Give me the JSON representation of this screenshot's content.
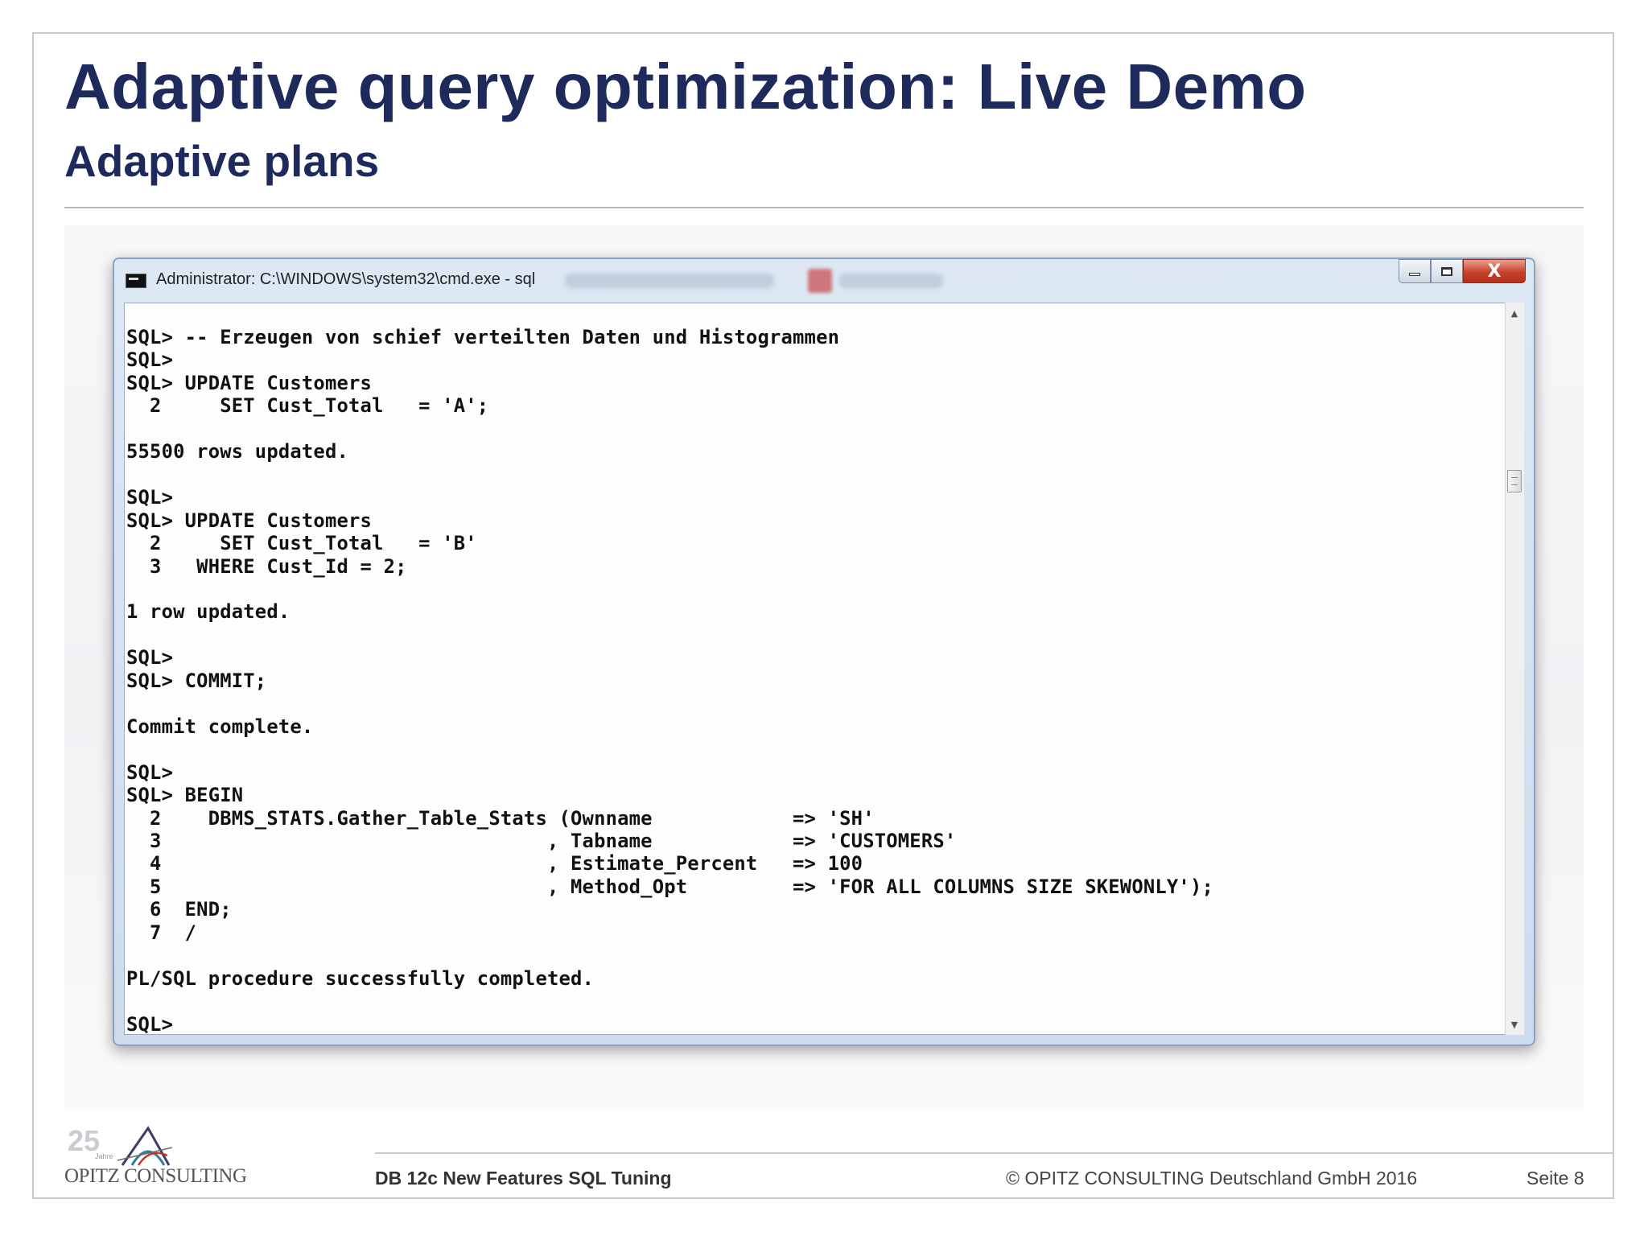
{
  "slide": {
    "title": "Adaptive query optimization: Live Demo",
    "subtitle": "Adaptive plans"
  },
  "window": {
    "title": "Administrator: C:\\WINDOWS\\system32\\cmd.exe - sql",
    "close_glyph": "X",
    "console_lines": [
      "SQL> -- Erzeugen von schief verteilten Daten und Histogrammen",
      "SQL>",
      "SQL> UPDATE Customers",
      "  2     SET Cust_Total   = 'A';",
      "",
      "55500 rows updated.",
      "",
      "SQL>",
      "SQL> UPDATE Customers",
      "  2     SET Cust_Total   = 'B'",
      "  3   WHERE Cust_Id = 2;",
      "",
      "1 row updated.",
      "",
      "SQL>",
      "SQL> COMMIT;",
      "",
      "Commit complete.",
      "",
      "SQL>",
      "SQL> BEGIN",
      "  2    DBMS_STATS.Gather_Table_Stats (Ownname            => 'SH'",
      "  3                                 , Tabname            => 'CUSTOMERS'",
      "  4                                 , Estimate_Percent   => 100",
      "  5                                 , Method_Opt         => 'FOR ALL COLUMNS SIZE SKEWONLY');",
      "  6  END;",
      "  7  /",
      "",
      "PL/SQL procedure successfully completed.",
      "",
      "SQL>"
    ]
  },
  "footer": {
    "logo_number": "25",
    "logo_small": "Jahre",
    "logo_text": "OPITZ CONSULTING",
    "left": "DB 12c New Features SQL Tuning",
    "copyright": "© OPITZ CONSULTING Deutschland GmbH 2016",
    "page": "Seite 8"
  },
  "colors": {
    "title": "#1f2a5c",
    "window_frame": "#cddcec",
    "close_button": "#c5412b",
    "console_bg": "#fefdfe"
  },
  "icons": [
    "cmd-icon",
    "minimize-icon",
    "maximize-icon",
    "close-icon",
    "scroll-up-icon",
    "scroll-down-icon",
    "logo-icon"
  ]
}
